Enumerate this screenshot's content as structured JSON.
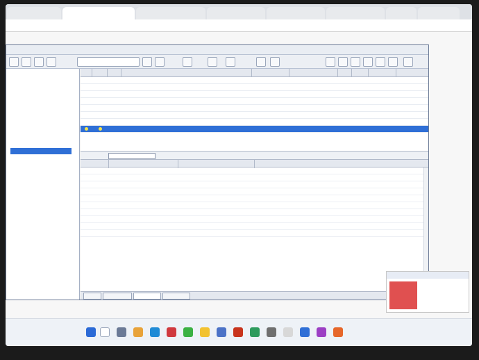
{
  "browser": {
    "tab_count": 8,
    "active_tab_index": 1
  },
  "app": {
    "tree": {
      "item_count": 32,
      "selected_index": 11
    },
    "rules": {
      "row_count": 8,
      "selected_index": 7
    },
    "log": {
      "row_count": 10
    },
    "bottom_tabs": {
      "count": 4,
      "active_index": 2
    }
  },
  "colors": {
    "selection": "#2f6fd6",
    "header_bg": "#e4e8ef",
    "notif_accent": "#e05050"
  }
}
